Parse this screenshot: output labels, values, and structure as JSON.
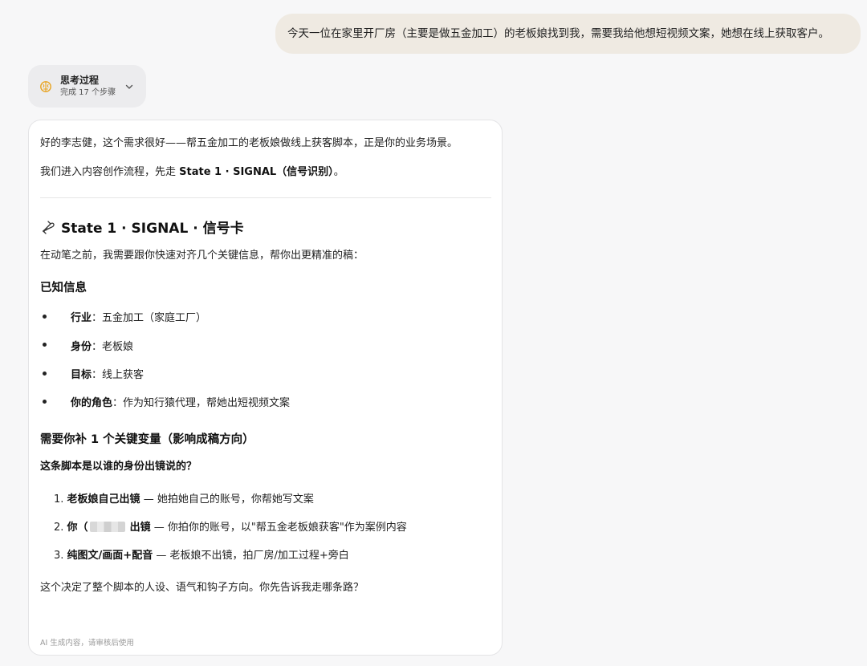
{
  "user_message": "今天一位在家里开厂房（主要是做五金加工）的老板娘找到我，需要我给他想短视频文案，她想在线上获取客户。",
  "thinking": {
    "title": "思考过程",
    "subtitle": "完成 17 个步骤",
    "icon": "brain-icon",
    "toggle_icon": "chevron-down-icon"
  },
  "response": {
    "greeting": "好的李志健，这个需求很好——帮五金加工的老板娘做线上获客脚本，正是你的业务场景。",
    "intro_prefix": "我们进入内容创作流程，先走 ",
    "intro_bold": "State 1 · SIGNAL（信号识别）",
    "intro_suffix": "。",
    "state_heading": "State 1 · SIGNAL · 信号卡",
    "state_icon": "bell-icon",
    "lead": "在动笔之前，我需要跟你快速对齐几个关键信息，帮你出更精准的稿：",
    "known_heading": "已知信息",
    "known": [
      {
        "label": "行业",
        "value": "：五金加工（家庭工厂）"
      },
      {
        "label": "身份",
        "value": "：老板娘"
      },
      {
        "label": "目标",
        "value": "：线上获客"
      },
      {
        "label": "你的角色",
        "value": "：作为知行猿代理，帮她出短视频文案"
      }
    ],
    "need_heading": "需要你补 1 个关键变量（影响成稿方向）",
    "question": "这条脚本是以谁的身份出镜说的？",
    "options": [
      {
        "num": "1.",
        "bold": "老板娘自己出镜",
        "rest": " — 她拍她自己的账号，你帮她写文案"
      },
      {
        "num": "2.",
        "bold_prefix": "你（",
        "bold_suffix": "出镜",
        "rest": " — 你拍你的账号，以\"帮五金老板娘获客\"作为案例内容"
      },
      {
        "num": "3.",
        "bold": "纯图文/画面+配音",
        "rest": " — 老板娘不出镜，拍厂房/加工过程+旁白"
      }
    ],
    "closing": "这个决定了整个脚本的人设、语气和钩子方向。你先告诉我走哪条路？",
    "footer": "AI 生成内容，请审核后使用"
  }
}
